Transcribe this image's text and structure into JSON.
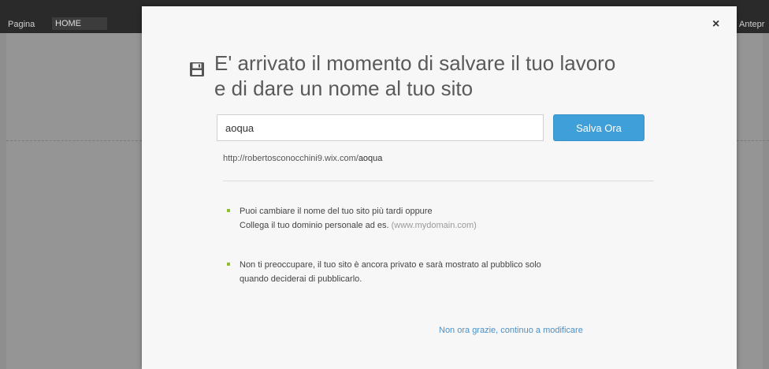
{
  "background": {
    "page_label": "Pagina",
    "page_value": "HOME",
    "right_label": "Antepr"
  },
  "modal": {
    "close_glyph": "×",
    "icon": "save-icon",
    "title_line1": "E' arrivato il momento di salvare il tuo lavoro",
    "title_line2": "e di dare un nome al tuo sito",
    "site_name_value": "aoqua",
    "save_button_label": "Salva Ora",
    "url_prefix": "http://robertosconocchini9.wix.com/",
    "url_name": "aoqua",
    "tips": [
      {
        "line1": "Puoi cambiare il nome del tuo sito più tardi oppure",
        "line2": "Collega il tuo dominio personale ad es.",
        "example": "(www.mydomain.com)"
      },
      {
        "line1": "Non ti preoccupare, il tuo sito è ancora privato e sarà mostrato al pubblico solo",
        "line2": "quando deciderai di pubblicarlo."
      }
    ],
    "later_link": "Non ora grazie, continuo a modificare"
  },
  "colors": {
    "accent_button": "#3f9fd9",
    "link": "#4a90c9",
    "bullet": "#8fbf2a"
  }
}
